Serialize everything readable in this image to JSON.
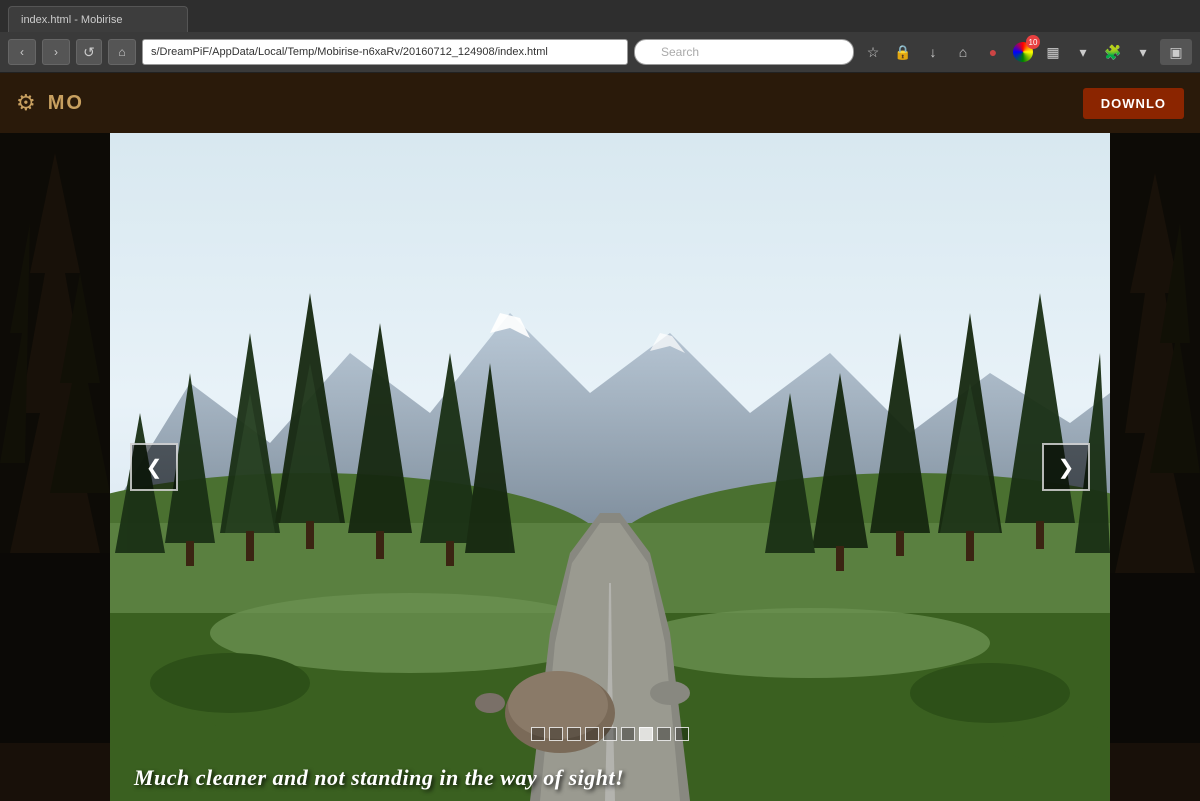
{
  "browser": {
    "tab_label": "index.html - Mobirise",
    "address": "s/DreamPiF/AppData/Local/Temp/Mobirise-n6xaRv/20160712_124908/index.html",
    "search_placeholder": "Search",
    "reload_symbol": "↺",
    "back_symbol": "‹",
    "forward_symbol": "›",
    "home_symbol": "⌂",
    "bookmark_symbol": "☆",
    "shield_symbol": "🔒",
    "download_symbol": "↓",
    "extensions_badge": "10"
  },
  "app": {
    "title": "MO",
    "gear_symbol": "⚙",
    "download_label": "DOWNLO"
  },
  "carousel": {
    "caption": "Much cleaner and not standing in the way of sight!",
    "prev_symbol": "❮",
    "next_symbol": "❯",
    "dots_count": 9,
    "active_dot": 6
  },
  "dots": [
    {
      "active": false
    },
    {
      "active": false
    },
    {
      "active": false
    },
    {
      "active": false
    },
    {
      "active": false
    },
    {
      "active": false
    },
    {
      "active": true
    },
    {
      "active": false
    },
    {
      "active": false
    }
  ]
}
